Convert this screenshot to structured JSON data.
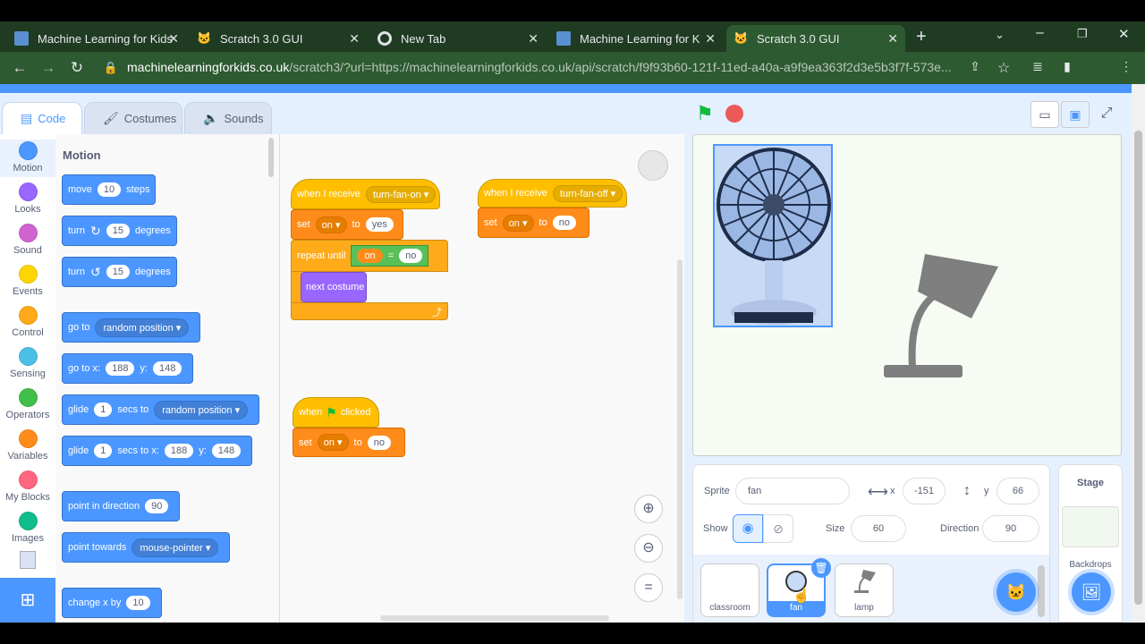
{
  "browser": {
    "tabs": [
      {
        "title": "Machine Learning for Kids",
        "icon": "ml4k-icon",
        "active": false
      },
      {
        "title": "Scratch 3.0 GUI",
        "icon": "cat-icon",
        "active": false
      },
      {
        "title": "New Tab",
        "icon": "chrome-icon",
        "active": false
      },
      {
        "title": "Machine Learning for Kids",
        "icon": "ml4k-icon",
        "active": false
      },
      {
        "title": "Scratch 3.0 GUI",
        "icon": "cat-icon",
        "active": true
      }
    ],
    "url_host": "machinelearningforkids.co.uk",
    "url_rest": "/scratch3/?url=https://machinelearningforkids.co.uk/api/scratch/f9f93b60-121f-11ed-a40a-a9f9ea363f2d3e5b3f7f-573e...",
    "profile_initial": "c"
  },
  "editor_tabs": {
    "code": "Code",
    "costumes": "Costumes",
    "sounds": "Sounds"
  },
  "categories": [
    {
      "label": "Motion",
      "color": "#4c97ff"
    },
    {
      "label": "Looks",
      "color": "#9966ff"
    },
    {
      "label": "Sound",
      "color": "#cf63cf"
    },
    {
      "label": "Events",
      "color": "#ffd500"
    },
    {
      "label": "Control",
      "color": "#ffab19"
    },
    {
      "label": "Sensing",
      "color": "#4cbfe6"
    },
    {
      "label": "Operators",
      "color": "#40bf4a"
    },
    {
      "label": "Variables",
      "color": "#ff8c1a"
    },
    {
      "label": "My Blocks",
      "color": "#ff6680"
    },
    {
      "label": "Images",
      "color": "#0fbd8c"
    }
  ],
  "palette": {
    "heading": "Motion",
    "move": {
      "a": "move",
      "v": "10",
      "b": "steps"
    },
    "turn_cw": {
      "a": "turn",
      "v": "15",
      "b": "degrees"
    },
    "turn_ccw": {
      "a": "turn",
      "v": "15",
      "b": "degrees"
    },
    "goto": {
      "a": "go to",
      "d": "random position"
    },
    "gotoxy": {
      "a": "go to x:",
      "x": "188",
      "yl": "y:",
      "y": "148"
    },
    "glide": {
      "a": "glide",
      "v": "1",
      "b": "secs to",
      "d": "random position"
    },
    "glidexy": {
      "a": "glide",
      "v": "1",
      "b": "secs to x:",
      "x": "188",
      "yl": "y:",
      "y": "148"
    },
    "point_dir": {
      "a": "point in direction",
      "v": "90"
    },
    "point_towards": {
      "a": "point towards",
      "d": "mouse-pointer"
    },
    "change_x": {
      "a": "change x by",
      "v": "10"
    }
  },
  "scripts": {
    "s1": {
      "hat": "when I receive",
      "msg": "turn-fan-on",
      "set": "set",
      "var": "on",
      "to": "to",
      "val": "yes",
      "repeat": "repeat until",
      "lhs": "on",
      "eq": "=",
      "rhs": "no",
      "next": "next costume"
    },
    "s2": {
      "hat": "when I receive",
      "msg": "turn-fan-off",
      "set": "set",
      "var": "on",
      "to": "to",
      "val": "no"
    },
    "s3": {
      "hat_a": "when",
      "hat_b": "clicked",
      "set": "set",
      "var": "on",
      "to": "to",
      "val": "no"
    }
  },
  "sprite_info": {
    "sprite_label": "Sprite",
    "sprite_name": "fan",
    "x_label": "x",
    "x": "-151",
    "y_label": "y",
    "y": "66",
    "show_label": "Show",
    "size_label": "Size",
    "size": "60",
    "direction_label": "Direction",
    "direction": "90"
  },
  "sprites": [
    {
      "name": "classroom",
      "selected": false
    },
    {
      "name": "fan",
      "selected": true
    },
    {
      "name": "lamp",
      "selected": false
    }
  ],
  "stage_panel": {
    "title": "Stage",
    "backdrops": "Backdrops"
  },
  "colors": {
    "motion": "#4c97ff",
    "events": "#ffbf00",
    "variables": "#ff8c1a",
    "operators": "#59c059",
    "looks": "#9966ff",
    "browser_green": "#2e5a31"
  }
}
